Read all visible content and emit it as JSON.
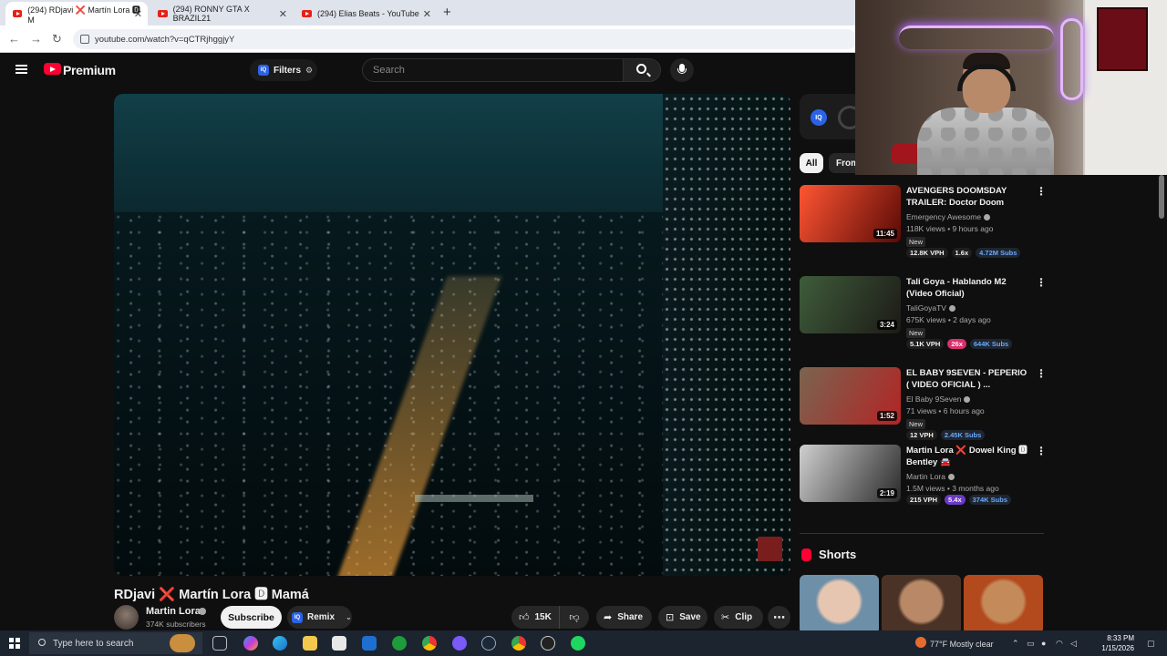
{
  "browser": {
    "tabs": [
      {
        "label": "(294) RDjavi ❌ Martín Lora 🅳 M",
        "active": true
      },
      {
        "label": "(294) RONNY GTA X BRAZIL21",
        "active": false
      },
      {
        "label": "(294) Elias Beats - YouTube",
        "active": false
      }
    ],
    "url": "youtube.com/watch?v=qCTRjhggjyY"
  },
  "header": {
    "brand": "Premium",
    "filters_label": "Filters",
    "search_placeholder": "Search",
    "iq_badge": "IQ"
  },
  "video": {
    "title": "RDjavi ❌ Martín Lora 🅳 Mamá",
    "channel": "Martin Lora",
    "subscribers": "374K subscribers",
    "subscribe_label": "Subscribe",
    "remix_label": "Remix",
    "likes": "15K",
    "share_label": "Share",
    "save_label": "Save",
    "clip_label": "Clip"
  },
  "sidebar": {
    "chips": [
      "All",
      "From"
    ],
    "recommendations": [
      {
        "title": "AVENGERS DOOMSDAY TRAILER: Doctor Doom Hidde...",
        "channel": "Emergency Awesome",
        "meta": "118K views • 9 hours ago",
        "duration": "11:45",
        "tag": "New",
        "vph": "12.8K VPH",
        "mult": "1.6x",
        "subs": "4.72M Subs",
        "mult_style": "plain",
        "thumb_colors": [
          "#ff5533",
          "#5a0a06"
        ]
      },
      {
        "title": "Tali Goya - Hablando M2 (Video Oficial)",
        "channel": "TaliGoyaTV",
        "meta": "675K views • 2 days ago",
        "duration": "3:24",
        "tag": "New",
        "vph": "5.1K VPH",
        "mult": "26x",
        "subs": "644K Subs",
        "mult_style": "hot",
        "thumb_colors": [
          "#3e5c3a",
          "#1d1a17"
        ]
      },
      {
        "title": "EL BABY 9SEVEN - PEPERIO ( VIDEO OFICIAL ) ...",
        "channel": "El Baby 9Seven",
        "meta": "71 views • 6 hours ago",
        "duration": "1:52",
        "tag": "New",
        "vph": "12 VPH",
        "mult": "",
        "subs": "2.45K Subs",
        "mult_style": "plain",
        "thumb_colors": [
          "#7a6450",
          "#b32424"
        ]
      },
      {
        "title": "Martin Lora ❌ Dowel King 🅳 Bentley 🚘",
        "channel": "Martin Lora",
        "meta": "1.5M views • 3 months ago",
        "duration": "2:19",
        "tag": "",
        "vph": "215 VPH",
        "mult": "5.4x",
        "subs": "374K Subs",
        "mult_style": "purple",
        "thumb_colors": [
          "#cfcfcf",
          "#2a2a2a"
        ]
      }
    ],
    "shorts_title": "Shorts"
  },
  "taskbar": {
    "search_placeholder": "Type here to search",
    "weather": "77°F  Mostly clear",
    "time": "8:33 PM",
    "date": "1/15/2026"
  },
  "colors": {
    "background": "#0f0f0f",
    "brand_red": "#ff0033",
    "iq_blue": "#2b63e6"
  }
}
